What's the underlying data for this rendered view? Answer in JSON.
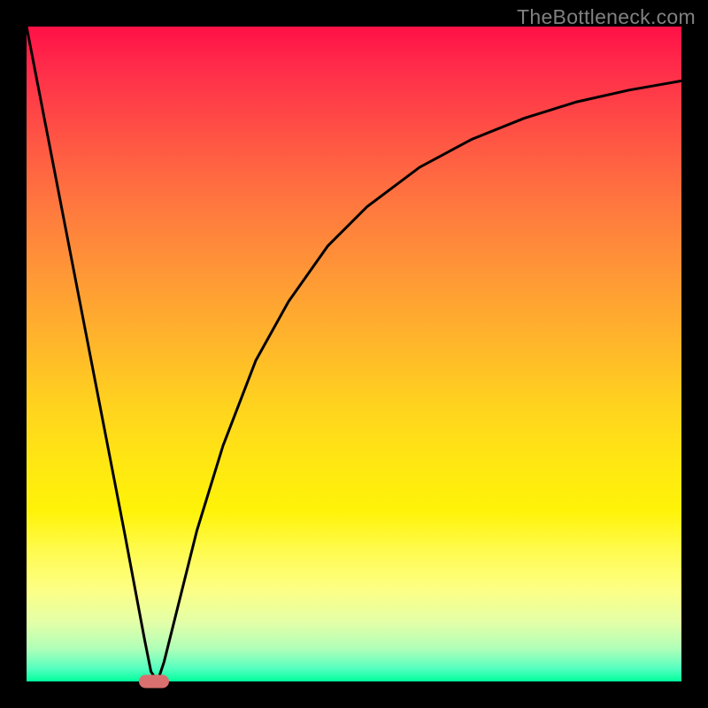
{
  "watermark": "TheBottleneck.com",
  "chart_data": {
    "type": "line",
    "title": "",
    "xlabel": "",
    "ylabel": "",
    "xlim": [
      0,
      100
    ],
    "ylim": [
      0,
      100
    ],
    "series": [
      {
        "name": "curve",
        "x": [
          0,
          3,
          6,
          9,
          12,
          15,
          18,
          19,
          20,
          21,
          23,
          26,
          30,
          35,
          40,
          46,
          52,
          60,
          68,
          76,
          84,
          92,
          100
        ],
        "y": [
          100,
          84.5,
          69,
          53.5,
          38,
          22.5,
          6.5,
          1.5,
          0,
          3,
          11,
          23,
          36,
          49,
          58,
          66.5,
          72.5,
          78.5,
          82.8,
          86,
          88.5,
          90.3,
          91.7
        ]
      }
    ],
    "marker": {
      "x": 19.4,
      "y": 0
    },
    "gradient_stops": [
      {
        "pos": 0,
        "color": "#ff1046"
      },
      {
        "pos": 20,
        "color": "#ff6a40"
      },
      {
        "pos": 50,
        "color": "#ffc424"
      },
      {
        "pos": 75,
        "color": "#fff630"
      },
      {
        "pos": 92,
        "color": "#c8ffa8"
      },
      {
        "pos": 100,
        "color": "#00ff9c"
      }
    ]
  }
}
